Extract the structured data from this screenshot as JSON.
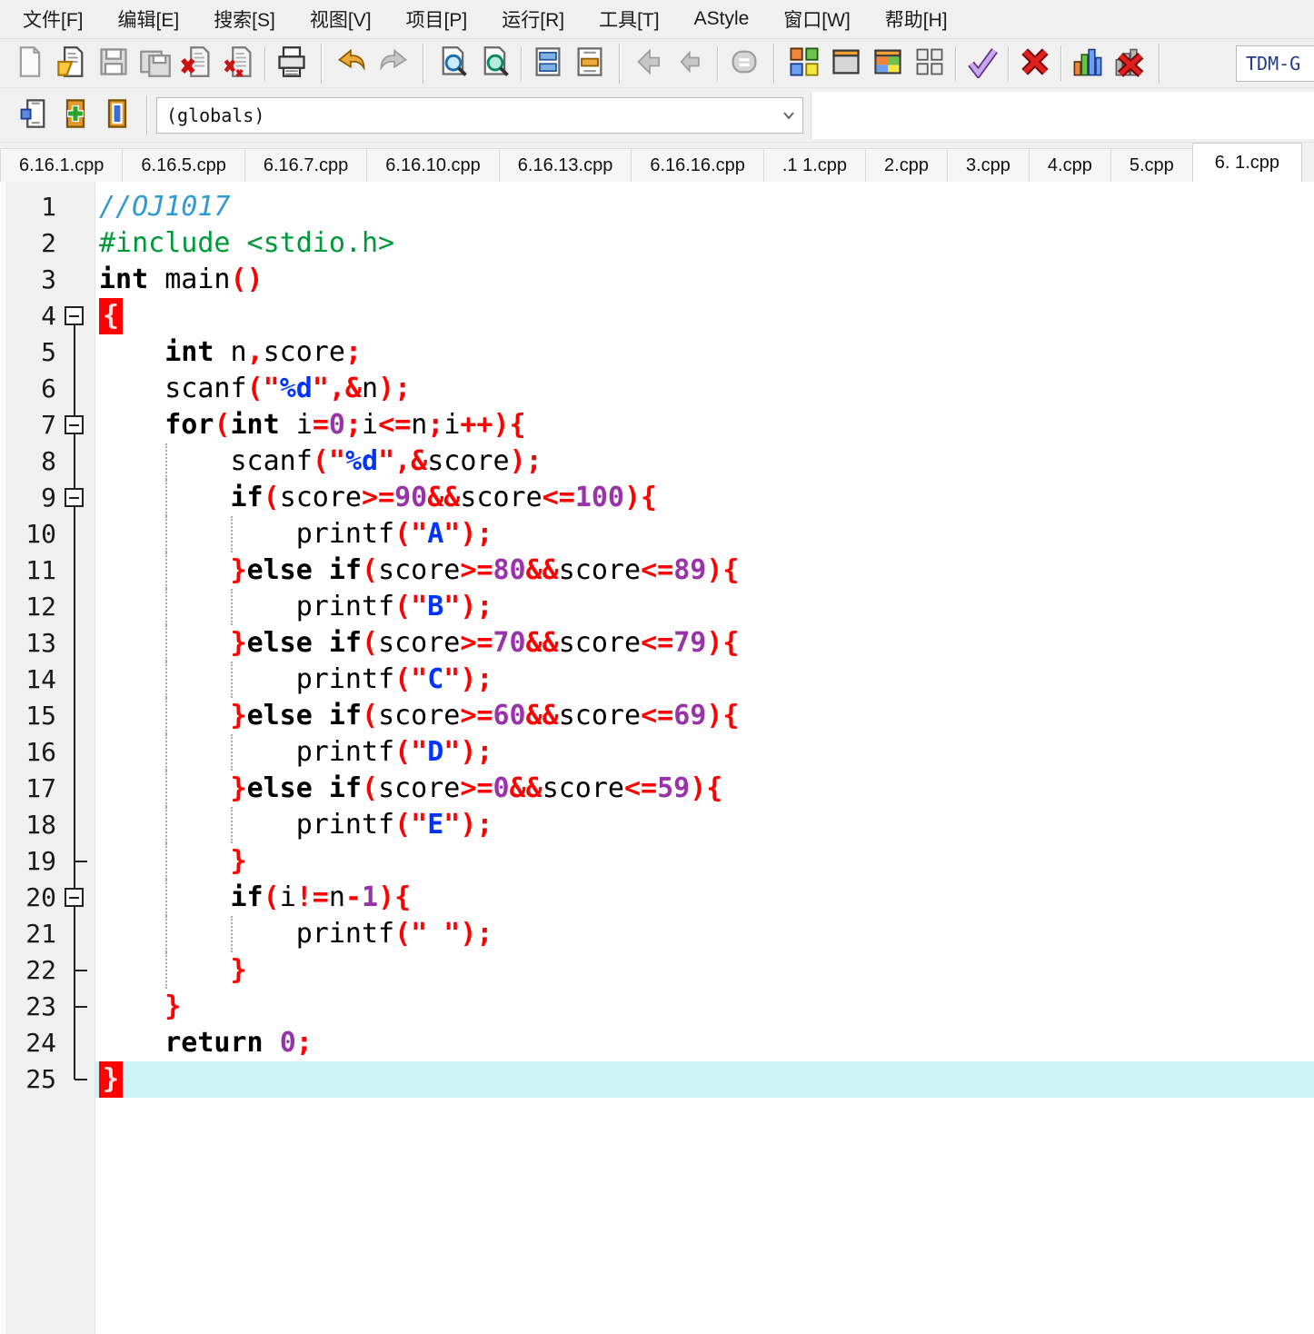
{
  "menu": {
    "items": [
      {
        "id": "file",
        "label": "文件[F]"
      },
      {
        "id": "edit",
        "label": "编辑[E]"
      },
      {
        "id": "search",
        "label": "搜索[S]"
      },
      {
        "id": "view",
        "label": "视图[V]"
      },
      {
        "id": "project",
        "label": "项目[P]"
      },
      {
        "id": "run",
        "label": "运行[R]"
      },
      {
        "id": "tools",
        "label": "工具[T]"
      },
      {
        "id": "astyle",
        "label": "AStyle"
      },
      {
        "id": "window",
        "label": "窗口[W]"
      },
      {
        "id": "help",
        "label": "帮助[H]"
      }
    ]
  },
  "toolbar": {
    "row1": [
      {
        "type": "btn",
        "id": "new-file",
        "disabled": true
      },
      {
        "type": "btn",
        "id": "open-file"
      },
      {
        "type": "btn",
        "id": "save",
        "disabled": true
      },
      {
        "type": "btn",
        "id": "save-all",
        "disabled": true
      },
      {
        "type": "btn",
        "id": "close-file"
      },
      {
        "type": "btn",
        "id": "close-all"
      },
      {
        "type": "sep"
      },
      {
        "type": "btn",
        "id": "print"
      },
      {
        "type": "band"
      },
      {
        "type": "btn",
        "id": "undo"
      },
      {
        "type": "btn",
        "id": "redo",
        "disabled": true
      },
      {
        "type": "band"
      },
      {
        "type": "btn",
        "id": "find"
      },
      {
        "type": "btn",
        "id": "find-in-files"
      },
      {
        "type": "sep"
      },
      {
        "type": "btn",
        "id": "swap-header-source"
      },
      {
        "type": "btn",
        "id": "replace"
      },
      {
        "type": "band"
      },
      {
        "type": "btn",
        "id": "back",
        "disabled": true
      },
      {
        "type": "btn",
        "id": "forward",
        "disabled": true
      },
      {
        "type": "sep"
      },
      {
        "type": "btn",
        "id": "goto-definition",
        "disabled": true
      },
      {
        "type": "band"
      },
      {
        "type": "btn",
        "id": "compile"
      },
      {
        "type": "btn",
        "id": "run"
      },
      {
        "type": "btn",
        "id": "compile-run"
      },
      {
        "type": "btn",
        "id": "rebuild"
      },
      {
        "type": "sep"
      },
      {
        "type": "btn",
        "id": "syntax-check"
      },
      {
        "type": "sep"
      },
      {
        "type": "btn",
        "id": "abort-compilation"
      },
      {
        "type": "sep"
      },
      {
        "type": "btn",
        "id": "profile"
      },
      {
        "type": "btn",
        "id": "delete-profiling"
      },
      {
        "type": "band"
      }
    ],
    "compiler_combo": {
      "value": "TDM-G"
    },
    "row2": [
      {
        "type": "btn",
        "id": "goto-declaration"
      },
      {
        "type": "btn",
        "id": "add-to-project"
      },
      {
        "type": "btn",
        "id": "remove-from-project"
      },
      {
        "type": "band"
      }
    ],
    "globals_combo": {
      "value": "(globals)"
    }
  },
  "tabs": {
    "items": [
      {
        "label": "6.16.1.cpp"
      },
      {
        "label": "6.16.5.cpp"
      },
      {
        "label": "6.16.7.cpp"
      },
      {
        "label": "6.16.10.cpp"
      },
      {
        "label": "6.16.13.cpp"
      },
      {
        "label": "6.16.16.cpp"
      },
      {
        "label": ".1 1.cpp"
      },
      {
        "label": "2.cpp"
      },
      {
        "label": "3.cpp"
      },
      {
        "label": "4.cpp"
      },
      {
        "label": "5.cpp"
      },
      {
        "label": "6. 1.cpp",
        "active": true
      }
    ]
  },
  "editor": {
    "colors": {
      "comment": "#2e9bd6",
      "preprocessor": "#009939",
      "keyword": "#000000",
      "symbol": "#ff0000",
      "number": "#9933aa",
      "string_content": "#0033ff",
      "brace_match_bg": "#ff0000",
      "current_line_bg": "#cdf4f4"
    },
    "lines": [
      {
        "n": 1,
        "f": "",
        "g": [],
        "tk": [
          [
            "c",
            "//OJ1017"
          ]
        ]
      },
      {
        "n": 2,
        "f": "",
        "g": [],
        "tk": [
          [
            "d",
            "#include <stdio.h>"
          ]
        ]
      },
      {
        "n": 3,
        "f": "",
        "g": [],
        "tk": [
          [
            "k",
            "int"
          ],
          [
            "t",
            " main"
          ],
          [
            "p",
            "()"
          ]
        ]
      },
      {
        "n": 4,
        "f": "box",
        "g": [],
        "tk": [
          [
            "bh",
            "{"
          ]
        ]
      },
      {
        "n": 5,
        "f": "line",
        "g": [],
        "tk": [
          [
            "t",
            "    "
          ],
          [
            "k",
            "int"
          ],
          [
            "t",
            " n"
          ],
          [
            "p",
            ","
          ],
          [
            "t",
            "score"
          ],
          [
            "p",
            ";"
          ]
        ]
      },
      {
        "n": 6,
        "f": "line",
        "g": [],
        "tk": [
          [
            "t",
            "    scanf"
          ],
          [
            "p",
            "("
          ],
          [
            "q",
            "\""
          ],
          [
            "s",
            "%d"
          ],
          [
            "q",
            "\""
          ],
          [
            "p",
            ",&"
          ],
          [
            "t",
            "n"
          ],
          [
            "p",
            ");"
          ]
        ]
      },
      {
        "n": 7,
        "f": "box",
        "g": [],
        "tk": [
          [
            "t",
            "    "
          ],
          [
            "k",
            "for"
          ],
          [
            "p",
            "("
          ],
          [
            "k",
            "int"
          ],
          [
            "t",
            " i"
          ],
          [
            "p",
            "="
          ],
          [
            "num",
            "0"
          ],
          [
            "p",
            ";"
          ],
          [
            "t",
            "i"
          ],
          [
            "p",
            "<="
          ],
          [
            "t",
            "n"
          ],
          [
            "p",
            ";"
          ],
          [
            "t",
            "i"
          ],
          [
            "p",
            "++){"
          ]
        ]
      },
      {
        "n": 8,
        "f": "line",
        "g": [
          4
        ],
        "tk": [
          [
            "t",
            "        scanf"
          ],
          [
            "p",
            "("
          ],
          [
            "q",
            "\""
          ],
          [
            "s",
            "%d"
          ],
          [
            "q",
            "\""
          ],
          [
            "p",
            ",&"
          ],
          [
            "t",
            "score"
          ],
          [
            "p",
            ");"
          ]
        ]
      },
      {
        "n": 9,
        "f": "box",
        "g": [
          4
        ],
        "tk": [
          [
            "t",
            "        "
          ],
          [
            "k",
            "if"
          ],
          [
            "p",
            "("
          ],
          [
            "t",
            "score"
          ],
          [
            "p",
            ">="
          ],
          [
            "num",
            "90"
          ],
          [
            "p",
            "&&"
          ],
          [
            "t",
            "score"
          ],
          [
            "p",
            "<="
          ],
          [
            "num",
            "100"
          ],
          [
            "p",
            "){"
          ]
        ]
      },
      {
        "n": 10,
        "f": "line",
        "g": [
          4,
          8
        ],
        "tk": [
          [
            "t",
            "            printf"
          ],
          [
            "p",
            "("
          ],
          [
            "q",
            "\""
          ],
          [
            "s",
            "A"
          ],
          [
            "q",
            "\""
          ],
          [
            "p",
            ");"
          ]
        ]
      },
      {
        "n": 11,
        "f": "line",
        "g": [
          4
        ],
        "tk": [
          [
            "t",
            "        "
          ],
          [
            "p",
            "}"
          ],
          [
            "k",
            "else"
          ],
          [
            "t",
            " "
          ],
          [
            "k",
            "if"
          ],
          [
            "p",
            "("
          ],
          [
            "t",
            "score"
          ],
          [
            "p",
            ">="
          ],
          [
            "num",
            "80"
          ],
          [
            "p",
            "&&"
          ],
          [
            "t",
            "score"
          ],
          [
            "p",
            "<="
          ],
          [
            "num",
            "89"
          ],
          [
            "p",
            "){"
          ]
        ]
      },
      {
        "n": 12,
        "f": "line",
        "g": [
          4,
          8
        ],
        "tk": [
          [
            "t",
            "            printf"
          ],
          [
            "p",
            "("
          ],
          [
            "q",
            "\""
          ],
          [
            "s",
            "B"
          ],
          [
            "q",
            "\""
          ],
          [
            "p",
            ");"
          ]
        ]
      },
      {
        "n": 13,
        "f": "line",
        "g": [
          4
        ],
        "tk": [
          [
            "t",
            "        "
          ],
          [
            "p",
            "}"
          ],
          [
            "k",
            "else"
          ],
          [
            "t",
            " "
          ],
          [
            "k",
            "if"
          ],
          [
            "p",
            "("
          ],
          [
            "t",
            "score"
          ],
          [
            "p",
            ">="
          ],
          [
            "num",
            "70"
          ],
          [
            "p",
            "&&"
          ],
          [
            "t",
            "score"
          ],
          [
            "p",
            "<="
          ],
          [
            "num",
            "79"
          ],
          [
            "p",
            "){"
          ]
        ]
      },
      {
        "n": 14,
        "f": "line",
        "g": [
          4,
          8
        ],
        "tk": [
          [
            "t",
            "            printf"
          ],
          [
            "p",
            "("
          ],
          [
            "q",
            "\""
          ],
          [
            "s",
            "C"
          ],
          [
            "q",
            "\""
          ],
          [
            "p",
            ");"
          ]
        ]
      },
      {
        "n": 15,
        "f": "line",
        "g": [
          4
        ],
        "tk": [
          [
            "t",
            "        "
          ],
          [
            "p",
            "}"
          ],
          [
            "k",
            "else"
          ],
          [
            "t",
            " "
          ],
          [
            "k",
            "if"
          ],
          [
            "p",
            "("
          ],
          [
            "t",
            "score"
          ],
          [
            "p",
            ">="
          ],
          [
            "num",
            "60"
          ],
          [
            "p",
            "&&"
          ],
          [
            "t",
            "score"
          ],
          [
            "p",
            "<="
          ],
          [
            "num",
            "69"
          ],
          [
            "p",
            "){"
          ]
        ]
      },
      {
        "n": 16,
        "f": "line",
        "g": [
          4,
          8
        ],
        "tk": [
          [
            "t",
            "            printf"
          ],
          [
            "p",
            "("
          ],
          [
            "q",
            "\""
          ],
          [
            "s",
            "D"
          ],
          [
            "q",
            "\""
          ],
          [
            "p",
            ");"
          ]
        ]
      },
      {
        "n": 17,
        "f": "line",
        "g": [
          4
        ],
        "tk": [
          [
            "t",
            "        "
          ],
          [
            "p",
            "}"
          ],
          [
            "k",
            "else"
          ],
          [
            "t",
            " "
          ],
          [
            "k",
            "if"
          ],
          [
            "p",
            "("
          ],
          [
            "t",
            "score"
          ],
          [
            "p",
            ">="
          ],
          [
            "num",
            "0"
          ],
          [
            "p",
            "&&"
          ],
          [
            "t",
            "score"
          ],
          [
            "p",
            "<="
          ],
          [
            "num",
            "59"
          ],
          [
            "p",
            "){"
          ]
        ]
      },
      {
        "n": 18,
        "f": "line",
        "g": [
          4,
          8
        ],
        "tk": [
          [
            "t",
            "            printf"
          ],
          [
            "p",
            "("
          ],
          [
            "q",
            "\""
          ],
          [
            "s",
            "E"
          ],
          [
            "q",
            "\""
          ],
          [
            "p",
            ");"
          ]
        ]
      },
      {
        "n": 19,
        "f": "tick",
        "g": [
          4
        ],
        "tk": [
          [
            "t",
            "        "
          ],
          [
            "p",
            "}"
          ]
        ]
      },
      {
        "n": 20,
        "f": "box",
        "g": [
          4
        ],
        "tk": [
          [
            "t",
            "        "
          ],
          [
            "k",
            "if"
          ],
          [
            "p",
            "("
          ],
          [
            "t",
            "i"
          ],
          [
            "p",
            "!="
          ],
          [
            "t",
            "n"
          ],
          [
            "p",
            "-"
          ],
          [
            "num",
            "1"
          ],
          [
            "p",
            "){"
          ]
        ]
      },
      {
        "n": 21,
        "f": "line",
        "g": [
          4,
          8
        ],
        "tk": [
          [
            "t",
            "            printf"
          ],
          [
            "p",
            "("
          ],
          [
            "q",
            "\""
          ],
          [
            "s",
            " "
          ],
          [
            "q",
            "\""
          ],
          [
            "p",
            ");"
          ]
        ]
      },
      {
        "n": 22,
        "f": "tick",
        "g": [
          4
        ],
        "tk": [
          [
            "t",
            "        "
          ],
          [
            "p",
            "}"
          ]
        ]
      },
      {
        "n": 23,
        "f": "tick",
        "g": [],
        "tk": [
          [
            "t",
            "    "
          ],
          [
            "p",
            "}"
          ]
        ]
      },
      {
        "n": 24,
        "f": "line",
        "g": [],
        "tk": [
          [
            "t",
            "    "
          ],
          [
            "k",
            "return"
          ],
          [
            "t",
            " "
          ],
          [
            "num",
            "0"
          ],
          [
            "p",
            ";"
          ]
        ]
      },
      {
        "n": 25,
        "f": "corner",
        "g": [],
        "hl": true,
        "tk": [
          [
            "bh",
            "}"
          ]
        ]
      }
    ]
  }
}
